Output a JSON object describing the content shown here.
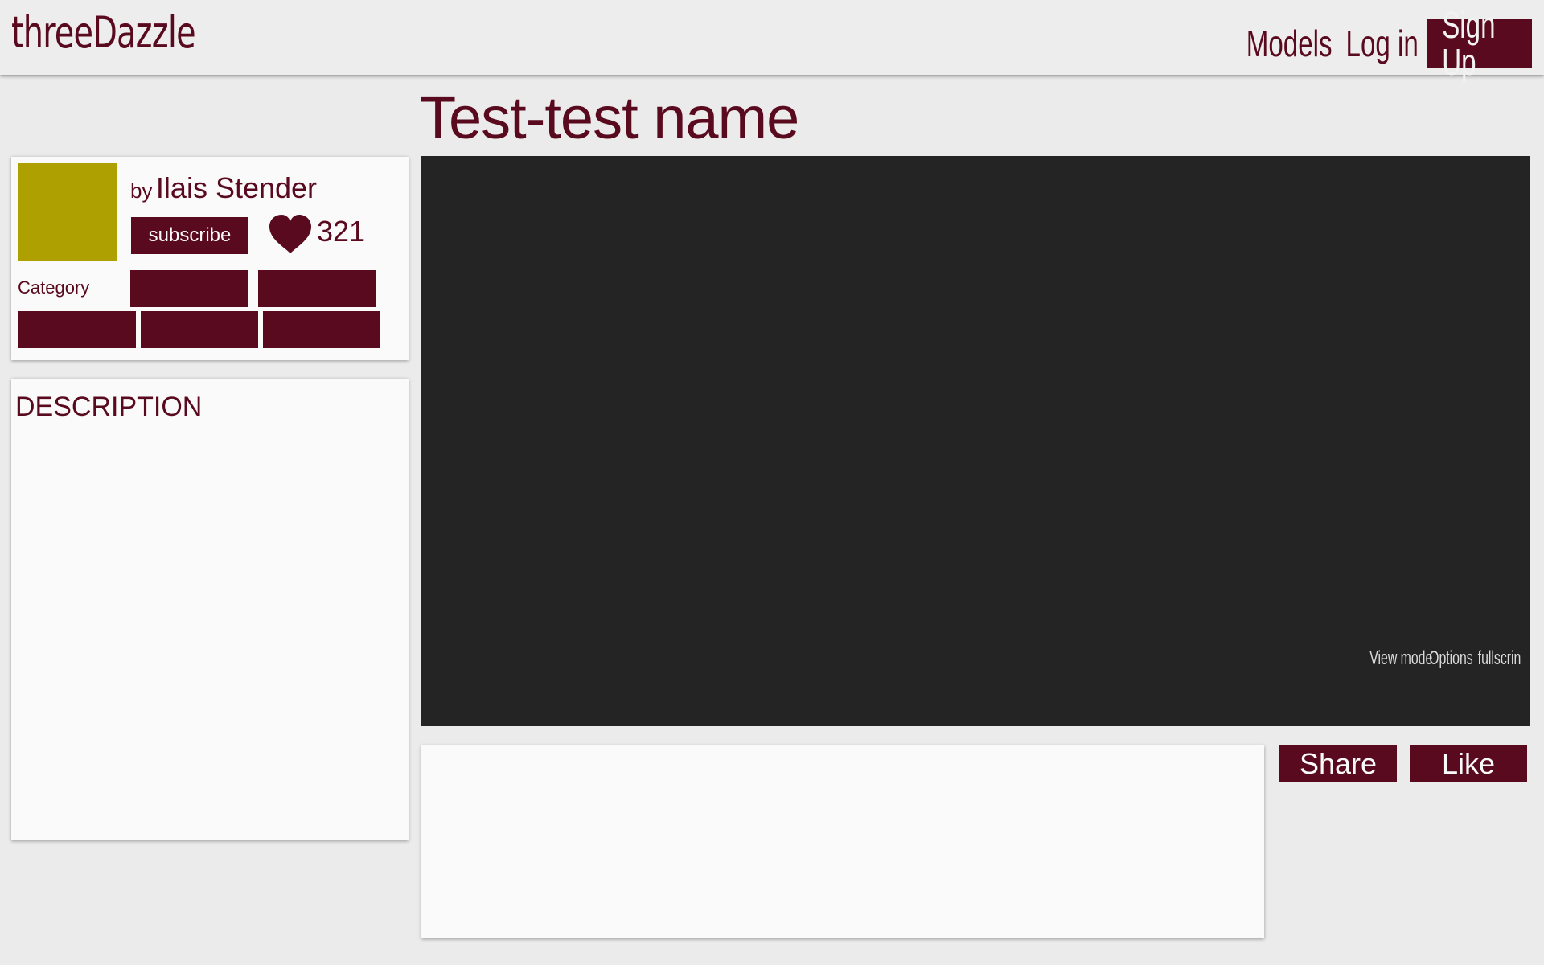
{
  "header": {
    "logo": "threeDazzle",
    "nav": {
      "models": "Models",
      "login": "Log in",
      "signup": "Sign Up"
    }
  },
  "model": {
    "title": "Test-test name",
    "author": {
      "by": "by",
      "name": "Ilais Stender"
    },
    "subscribe_label": "subscribe",
    "likes": "321",
    "category_label": "Category",
    "description_title": "DESCRIPTION"
  },
  "viewer": {
    "controls": [
      "View mode",
      "Options",
      "fullscrin"
    ]
  },
  "actions": {
    "share": "Share",
    "like": "Like"
  },
  "colors": {
    "brand": "#5a0a1e",
    "avatar": "#aea000",
    "viewer_bg": "#242424",
    "page_bg": "#ebebeb"
  }
}
